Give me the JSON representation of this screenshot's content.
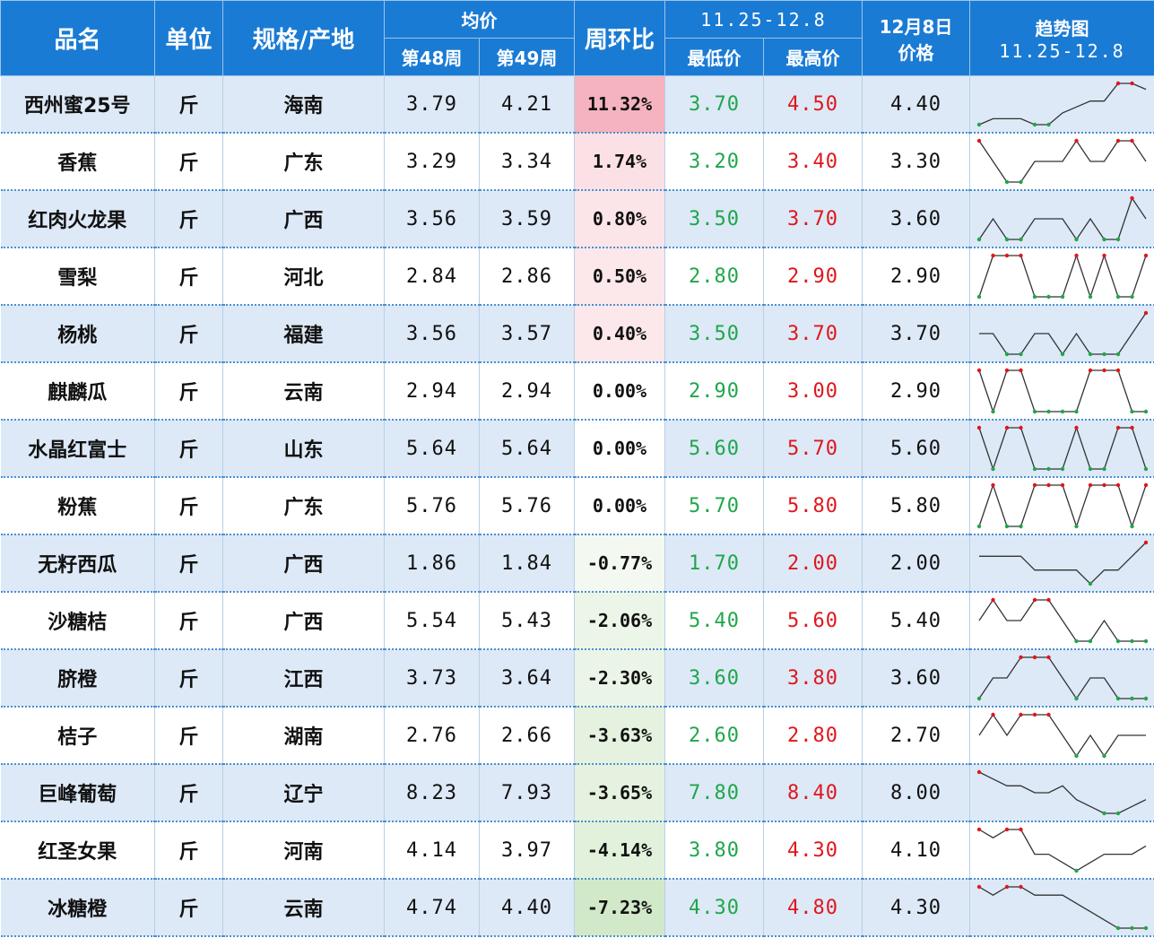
{
  "header": {
    "name": "品名",
    "unit": "单位",
    "origin": "规格/产地",
    "avg": "均价",
    "week48": "第48周",
    "week49": "第49周",
    "wow": "周环比",
    "range": "11.25-12.8",
    "low": "最低价",
    "high": "最高价",
    "price_line1": "12月8日",
    "price_line2": "价格",
    "trend_line1": "趋势图",
    "trend_line2": "11.25-12.8"
  },
  "colors": {
    "header_bg": "#1a7bd4",
    "low": "#1fa64a",
    "high": "#e0161c",
    "positive": "#f4b6c2",
    "negative": "#c6e3b4"
  },
  "rows": [
    {
      "name": "西州蜜25号",
      "unit": "斤",
      "origin": "海南",
      "w48": "3.79",
      "w49": "4.21",
      "wow": "11.32%",
      "low": "3.70",
      "high": "4.50",
      "price": "4.40",
      "trend": [
        3.8,
        3.9,
        3.9,
        3.9,
        3.8,
        3.8,
        4.0,
        4.1,
        4.2,
        4.2,
        4.5,
        4.5,
        4.4
      ]
    },
    {
      "name": "香蕉",
      "unit": "斤",
      "origin": "广东",
      "w48": "3.29",
      "w49": "3.34",
      "wow": "1.74%",
      "low": "3.20",
      "high": "3.40",
      "price": "3.30",
      "trend": [
        3.4,
        3.3,
        3.2,
        3.2,
        3.3,
        3.3,
        3.3,
        3.4,
        3.3,
        3.3,
        3.4,
        3.4,
        3.3
      ]
    },
    {
      "name": "红肉火龙果",
      "unit": "斤",
      "origin": "广西",
      "w48": "3.56",
      "w49": "3.59",
      "wow": "0.80%",
      "low": "3.50",
      "high": "3.70",
      "price": "3.60",
      "trend": [
        3.5,
        3.6,
        3.5,
        3.5,
        3.6,
        3.6,
        3.6,
        3.5,
        3.6,
        3.5,
        3.5,
        3.7,
        3.6
      ]
    },
    {
      "name": "雪梨",
      "unit": "斤",
      "origin": "河北",
      "w48": "2.84",
      "w49": "2.86",
      "wow": "0.50%",
      "low": "2.80",
      "high": "2.90",
      "price": "2.90",
      "trend": [
        2.8,
        2.9,
        2.9,
        2.9,
        2.8,
        2.8,
        2.8,
        2.9,
        2.8,
        2.9,
        2.8,
        2.8,
        2.9
      ]
    },
    {
      "name": "杨桃",
      "unit": "斤",
      "origin": "福建",
      "w48": "3.56",
      "w49": "3.57",
      "wow": "0.40%",
      "low": "3.50",
      "high": "3.70",
      "price": "3.70",
      "trend": [
        3.6,
        3.6,
        3.5,
        3.5,
        3.6,
        3.6,
        3.5,
        3.6,
        3.5,
        3.5,
        3.5,
        3.6,
        3.7
      ]
    },
    {
      "name": "麒麟瓜",
      "unit": "斤",
      "origin": "云南",
      "w48": "2.94",
      "w49": "2.94",
      "wow": "0.00%",
      "low": "2.90",
      "high": "3.00",
      "price": "2.90",
      "trend": [
        3.0,
        2.9,
        3.0,
        3.0,
        2.9,
        2.9,
        2.9,
        2.9,
        3.0,
        3.0,
        3.0,
        2.9,
        2.9
      ]
    },
    {
      "name": "水晶红富士",
      "unit": "斤",
      "origin": "山东",
      "w48": "5.64",
      "w49": "5.64",
      "wow": "0.00%",
      "low": "5.60",
      "high": "5.70",
      "price": "5.60",
      "trend": [
        5.7,
        5.6,
        5.7,
        5.7,
        5.6,
        5.6,
        5.6,
        5.7,
        5.6,
        5.6,
        5.7,
        5.7,
        5.6
      ]
    },
    {
      "name": "粉蕉",
      "unit": "斤",
      "origin": "广东",
      "w48": "5.76",
      "w49": "5.76",
      "wow": "0.00%",
      "low": "5.70",
      "high": "5.80",
      "price": "5.80",
      "trend": [
        5.7,
        5.8,
        5.7,
        5.7,
        5.8,
        5.8,
        5.8,
        5.7,
        5.8,
        5.8,
        5.8,
        5.7,
        5.8
      ]
    },
    {
      "name": "无籽西瓜",
      "unit": "斤",
      "origin": "广西",
      "w48": "1.86",
      "w49": "1.84",
      "wow": "-0.77%",
      "low": "1.70",
      "high": "2.00",
      "price": "2.00",
      "trend": [
        1.9,
        1.9,
        1.9,
        1.9,
        1.8,
        1.8,
        1.8,
        1.8,
        1.7,
        1.8,
        1.8,
        1.9,
        2.0
      ]
    },
    {
      "name": "沙糖桔",
      "unit": "斤",
      "origin": "广西",
      "w48": "5.54",
      "w49": "5.43",
      "wow": "-2.06%",
      "low": "5.40",
      "high": "5.60",
      "price": "5.40",
      "trend": [
        5.5,
        5.6,
        5.5,
        5.5,
        5.6,
        5.6,
        5.5,
        5.4,
        5.4,
        5.5,
        5.4,
        5.4,
        5.4
      ]
    },
    {
      "name": "脐橙",
      "unit": "斤",
      "origin": "江西",
      "w48": "3.73",
      "w49": "3.64",
      "wow": "-2.30%",
      "low": "3.60",
      "high": "3.80",
      "price": "3.60",
      "trend": [
        3.6,
        3.7,
        3.7,
        3.8,
        3.8,
        3.8,
        3.7,
        3.6,
        3.7,
        3.7,
        3.6,
        3.6,
        3.6
      ]
    },
    {
      "name": "桔子",
      "unit": "斤",
      "origin": "湖南",
      "w48": "2.76",
      "w49": "2.66",
      "wow": "-3.63%",
      "low": "2.60",
      "high": "2.80",
      "price": "2.70",
      "trend": [
        2.7,
        2.8,
        2.7,
        2.8,
        2.8,
        2.8,
        2.7,
        2.6,
        2.7,
        2.6,
        2.7,
        2.7,
        2.7
      ]
    },
    {
      "name": "巨峰葡萄",
      "unit": "斤",
      "origin": "辽宁",
      "w48": "8.23",
      "w49": "7.93",
      "wow": "-3.65%",
      "low": "7.80",
      "high": "8.40",
      "price": "8.00",
      "trend": [
        8.4,
        8.3,
        8.2,
        8.2,
        8.1,
        8.1,
        8.2,
        8.0,
        7.9,
        7.8,
        7.8,
        7.9,
        8.0
      ]
    },
    {
      "name": "红圣女果",
      "unit": "斤",
      "origin": "河南",
      "w48": "4.14",
      "w49": "3.97",
      "wow": "-4.14%",
      "low": "3.80",
      "high": "4.30",
      "price": "4.10",
      "trend": [
        4.3,
        4.2,
        4.3,
        4.3,
        4.0,
        4.0,
        3.9,
        3.8,
        3.9,
        4.0,
        4.0,
        4.0,
        4.1
      ]
    },
    {
      "name": "冰糖橙",
      "unit": "斤",
      "origin": "云南",
      "w48": "4.74",
      "w49": "4.40",
      "wow": "-7.23%",
      "low": "4.30",
      "high": "4.80",
      "price": "4.30",
      "trend": [
        4.8,
        4.7,
        4.8,
        4.8,
        4.7,
        4.7,
        4.7,
        4.6,
        4.5,
        4.4,
        4.3,
        4.3,
        4.3
      ]
    }
  ]
}
